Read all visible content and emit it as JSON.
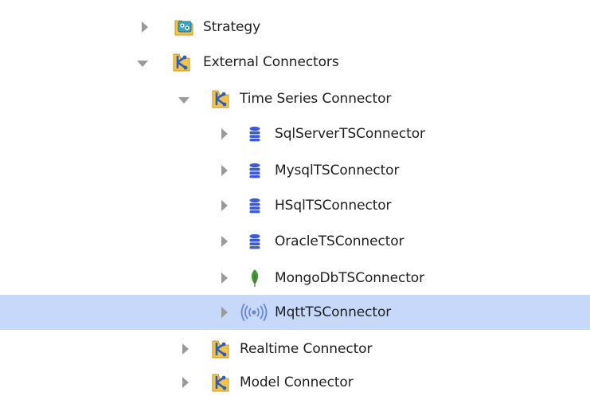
{
  "tree": {
    "items": [
      {
        "label": "Strategy",
        "icon": "strategy-icon",
        "state": "collapsed",
        "level": 0
      },
      {
        "label": "External Connectors",
        "icon": "connector-folder-icon",
        "state": "expanded",
        "level": 0
      },
      {
        "label": "Time Series Connector",
        "icon": "connector-folder-icon",
        "state": "expanded",
        "level": 1
      },
      {
        "label": "SqlServerTSConnector",
        "icon": "database-icon",
        "state": "collapsed",
        "level": 2
      },
      {
        "label": "MysqlTSConnector",
        "icon": "database-icon",
        "state": "collapsed",
        "level": 2
      },
      {
        "label": "HSqlTSConnector",
        "icon": "database-icon",
        "state": "collapsed",
        "level": 2
      },
      {
        "label": "OracleTSConnector",
        "icon": "database-icon",
        "state": "collapsed",
        "level": 2
      },
      {
        "label": "MongoDbTSConnector",
        "icon": "mongodb-leaf-icon",
        "state": "collapsed",
        "level": 2
      },
      {
        "label": "MqttTSConnector",
        "icon": "broadcast-signal-icon",
        "state": "collapsed",
        "level": 2,
        "selected": true
      },
      {
        "label": "Realtime Connector",
        "icon": "connector-folder-icon",
        "state": "collapsed",
        "level": 1
      },
      {
        "label": "Model Connector",
        "icon": "connector-folder-icon",
        "state": "collapsed",
        "level": 1
      }
    ]
  },
  "colors": {
    "selection": "#c7d9fb",
    "database": "#3b5bd6",
    "mongodb": "#3f9a32",
    "mqtt": "#6a86d8",
    "folder": "#f2c44c",
    "connector_nodes": "#2f5db8"
  }
}
